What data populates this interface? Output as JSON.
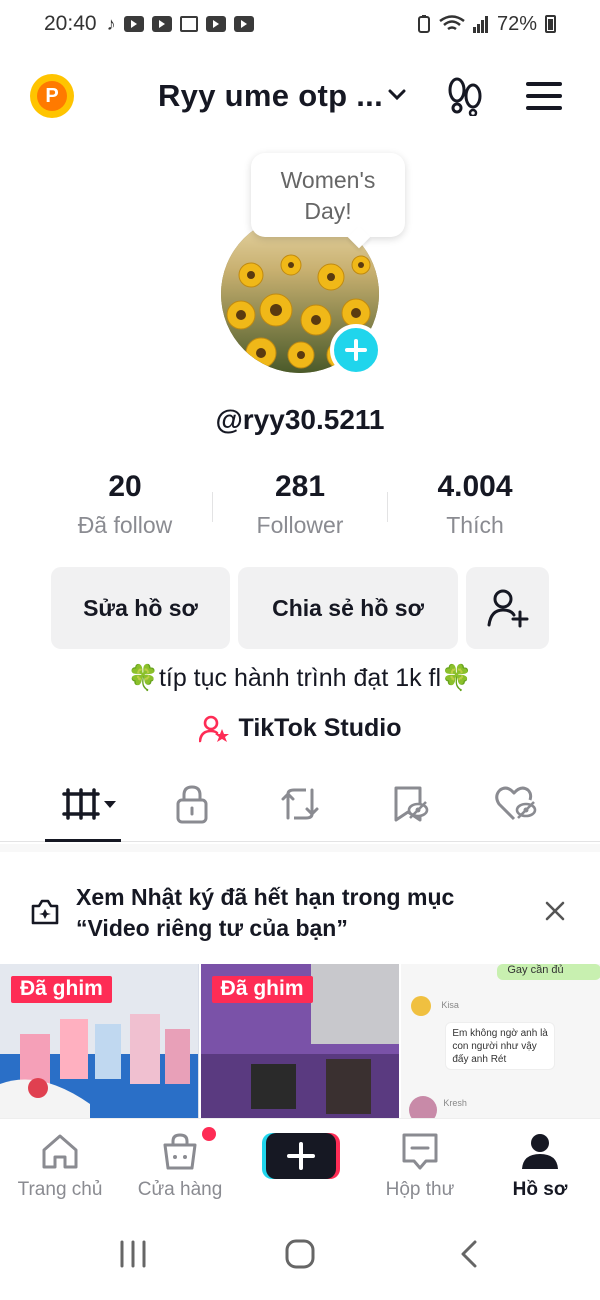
{
  "status_bar": {
    "time": "20:40",
    "battery": "72%"
  },
  "header": {
    "title": "Ryy ume otp ..."
  },
  "profile": {
    "note": [
      "Women's",
      "Day!"
    ],
    "handle": "@ryy30.5211",
    "stats": [
      {
        "value": "20",
        "label": "Đã follow"
      },
      {
        "value": "281",
        "label": "Follower"
      },
      {
        "value": "4.004",
        "label": "Thích"
      }
    ],
    "buttons": {
      "edit": "Sửa hồ sơ",
      "share": "Chia sẻ hồ sơ"
    },
    "bio": "🍀típ tục hành trình đạt 1k fl🍀",
    "studio": "TikTok Studio"
  },
  "notice": {
    "line1": "Xem Nhật ký đã hết hạn trong mục",
    "line2": "“Video riêng tư của bạn”"
  },
  "videos": [
    {
      "pinned_label": "Đã ghim"
    },
    {
      "pinned_label": "Đã ghim"
    },
    {
      "chat_name1": "Kisa",
      "chat_msg": "Em không ngờ anh là con người như vậy đấy anh Rét",
      "chat_name2": "Kresh",
      "chat_top": "Gay cần đủ"
    }
  ],
  "bottom_nav": [
    {
      "label": "Trang chủ"
    },
    {
      "label": "Cửa hàng"
    },
    {
      "label": ""
    },
    {
      "label": "Hộp thư"
    },
    {
      "label": "Hồ sơ"
    }
  ],
  "colors": {
    "accent": "#fe2c55",
    "cyan": "#20d5ec",
    "coin": "#ffc400"
  },
  "icons": [
    "coin-icon",
    "chevron-down-icon",
    "footprint-icon",
    "menu-icon",
    "plus-icon",
    "add-friend-icon",
    "studio-icon",
    "videos-tab-icon",
    "lock-icon",
    "repost-icon",
    "favorites-icon",
    "liked-icon",
    "diary-icon",
    "close-icon",
    "home-icon",
    "shop-icon",
    "create-icon",
    "inbox-icon",
    "profile-icon"
  ]
}
